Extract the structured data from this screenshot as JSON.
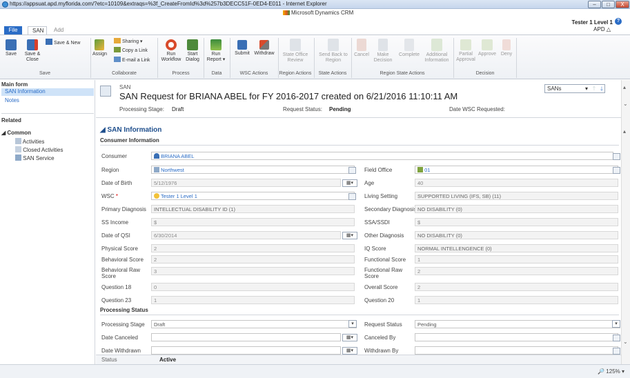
{
  "window": {
    "url": "https://appsuat.apd.myflorida.com/?etc=10109&extraqs=%3f_CreateFromId%3d%257b3DECC51F-0ED4-E011 - Internet Explorer",
    "minimize": "–",
    "maximize": "□",
    "close": "X"
  },
  "crm": {
    "brand": "Microsoft Dynamics CRM"
  },
  "tabs": {
    "file": "File",
    "san": "SAN",
    "add": "Add"
  },
  "user": {
    "name": "Tester 1 Level 1",
    "org": "APD △",
    "help": "?"
  },
  "ribbon": {
    "save": "Save",
    "save_close": "Save & Close",
    "save_new": "Save & New",
    "sharing": "Sharing ▾",
    "copy_link": "Copy a Link",
    "email_link": "E-mail a Link",
    "assign": "Assign",
    "run_workflow": "Run Workflow",
    "start_dialog": "Start Dialog",
    "run_report": "Run Report ▾",
    "submit": "Submit",
    "withdraw": "Withdraw",
    "state_office_review": "State Office Review",
    "send_back_region": "Send Back to Region",
    "cancel": "Cancel",
    "make_decision": "Make Decision",
    "complete": "Complete",
    "additional_info": "Additional Information",
    "partial_approval": "Partial Approval",
    "approve": "Approve",
    "deny": "Deny",
    "groups": {
      "save": "Save",
      "collaborate": "Collaborate",
      "process": "Process",
      "data": "Data",
      "wsc": "WSC Actions",
      "region": "Region Actions",
      "state": "State Actions",
      "region_state": "Region State Actions",
      "decision": "Decision"
    }
  },
  "leftnav": {
    "form": "Main form",
    "san_info": "SAN Information",
    "notes": "Notes",
    "related": "Related",
    "common": "◢ Common",
    "activities": "Activities",
    "closed_activities": "Closed Activities",
    "san_service": "SAN Service"
  },
  "header": {
    "entity": "SAN",
    "title": "SAN Request for BRIANA ABEL for FY 2016-2017 created on 6/21/2016 11:10:11 AM",
    "processing_stage_label": "Processing Stage:",
    "processing_stage": "Draft",
    "request_status_label": "Request Status:",
    "request_status": "Pending",
    "wsc_requested_label": "Date WSC Requested:",
    "view_select": "SANs"
  },
  "section": {
    "title": "SAN Information",
    "consumer_info": "Consumer Information",
    "processing_status": "Processing Status"
  },
  "fields": {
    "consumer_label": "Consumer",
    "consumer": "BRIANA ABEL",
    "region_label": "Region",
    "region": "Northwest",
    "field_office_label": "Field Office",
    "field_office": "01",
    "dob_label": "Date of Birth",
    "dob": "5/12/1976",
    "age_label": "Age",
    "age": "40",
    "wsc_label": "WSC",
    "wsc": "Tester 1 Level 1",
    "living_label": "Living Setting",
    "living": "SUPPORTED LIVING (IFS, SB) (11)",
    "primary_dx_label": "Primary Diagnosis",
    "primary_dx": "INTELLECTUAL DISABILITY ID (1)",
    "secondary_dx_label": "Secondary Diagnosis",
    "secondary_dx": "NO DISABILITY (0)",
    "ss_income_label": "SS Income",
    "ss_income": "$",
    "ssa_label": "SSA/SSDI",
    "ssa": "$",
    "qsi_label": "Date of QSI",
    "qsi": "6/30/2014",
    "other_dx_label": "Other Diagnosis",
    "other_dx": "NO DISABILITY (0)",
    "physical_label": "Physical Score",
    "physical": "2",
    "iq_label": "IQ Score",
    "iq": "NORMAL INTELLENGENCE (0)",
    "behavioral_label": "Behavioral Score",
    "behavioral": "2",
    "functional_label": "Functional Score",
    "functional": "1",
    "beh_raw_label": "Behavioral Raw Score",
    "beh_raw": "3",
    "func_raw_label": "Functional Raw Score",
    "func_raw": "2",
    "q18_label": "Question 18",
    "q18": "0",
    "overall_label": "Overall Score",
    "overall": "2",
    "q23_label": "Question 23",
    "q23": "1",
    "q20_label": "Question 20",
    "q20": "1",
    "ps_label": "Processing Stage",
    "ps": "Draft",
    "rs_label": "Request Status",
    "rs": "Pending",
    "date_canceled_label": "Date Canceled",
    "canceled_by_label": "Canceled By",
    "date_withdrawn_label": "Date Withdrawn",
    "withdrawn_by_label": "Withdrawn By",
    "status_label": "Status",
    "status": "Active"
  },
  "statusbar": {
    "zoom": "🔎 125% ▾"
  }
}
